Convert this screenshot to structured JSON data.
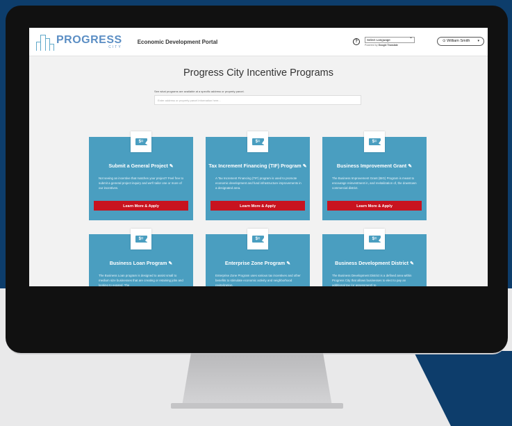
{
  "header": {
    "logo_word": "PROGRESS",
    "logo_sub": "CITY",
    "portal_title": "Economic Development Portal",
    "help_glyph": "?",
    "language_select": "Select Language",
    "powered_by": "Powered by",
    "powered_brand": "Google Translate",
    "user_icon": "⊙",
    "user_name": "William Smith",
    "user_caret": "▾"
  },
  "page": {
    "title": "Progress City Incentive Programs",
    "search_hint": "See what programs are available at a specific address or property parcel.",
    "search_placeholder": "Enter address or property parcel information here..."
  },
  "card_icon_glyph": "$=",
  "edit_icon_glyph": "✎",
  "cards": [
    {
      "title": "Submit a General Project",
      "desc": "Not seeing an incentive that matches your project? Feel free to submit a general project inquiry and we'll tailor one or more of our incentives.",
      "button": "Learn More & Apply"
    },
    {
      "title": "Tax Increment Financing (TIF) Program",
      "desc": "A Tax Increment Financing (TIF) program is used to promote economic development and fund infrastructure improvements in a designated area.",
      "button": "Learn More & Apply"
    },
    {
      "title": "Business Improvement Grant",
      "desc": "The Business Improvement Grant (BIG) Program is meant to encourage reinvestment in, and revitalization of, the downtown commercial district.",
      "button": "Learn More & Apply"
    },
    {
      "title": "Business Loan Program",
      "desc": "The Business Loan program is designed to assist small to medium size businesses that are creating or retaining jobs and looking to expand. The",
      "button": ""
    },
    {
      "title": "Enterprise Zone Program",
      "desc": "Enterprise Zone Program uses various tax incentives and other benefits to stimulate economic activity and neighborhood revitalization.",
      "button": ""
    },
    {
      "title": "Business Development District",
      "desc": "The Business Development District is a defined area within Progress City that allows businesses to elect to pay an additional tax (or assessment) to",
      "button": ""
    }
  ],
  "colors": {
    "background_navy": "#0d3d6b",
    "card_blue": "#4a9ec0",
    "button_red": "#c8131f"
  }
}
